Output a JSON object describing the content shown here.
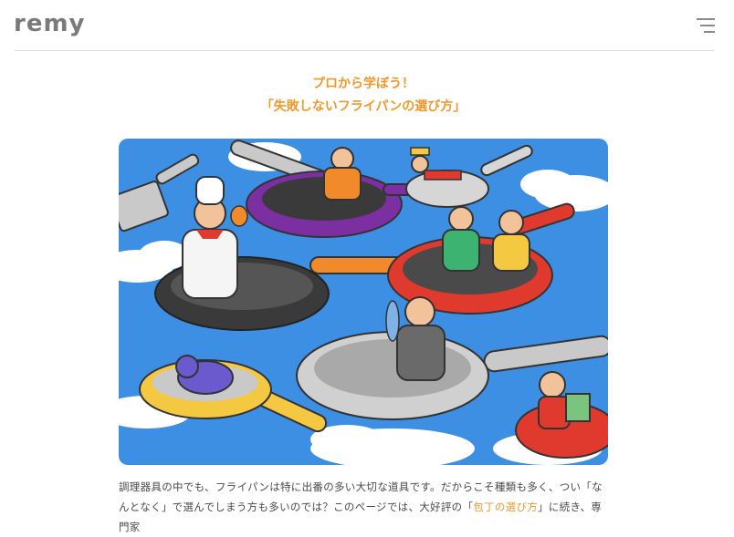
{
  "header": {
    "logo": "remy",
    "menu_icon": "hamburger-menu-icon"
  },
  "article": {
    "title_line1": "プロから学ぼう！",
    "title_line2": "「失敗しないフライパンの選び方」",
    "hero_image": "illustration-of-people-in-giant-frying-pans",
    "body_part1": "調理器具の中でも、フライパンは特に出番の多い大切な道具です。だからこそ種類も多く、つい「なんとなく」で選んでしまう方も多いのでは？このページでは、大好評の「",
    "body_link": "包丁の選び方",
    "body_part2": "」に続き、専門家"
  },
  "colors": {
    "accent": "#f0982b",
    "sky": "#3b8fe0",
    "text": "#4a4a4a"
  }
}
